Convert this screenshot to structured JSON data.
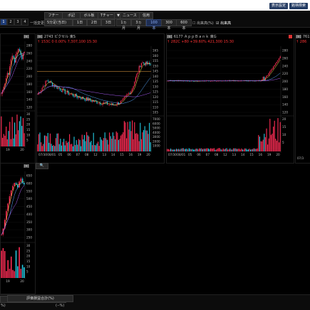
{
  "topbar": {
    "btn1": "表示設定",
    "btn2": "銘柄検索"
  },
  "toolbar": {
    "pages": [
      "1",
      "2",
      "3",
      "4"
    ],
    "list_label": "一括変更",
    "buttons": [
      "フチート",
      "ポ記",
      "ボル板",
      "Tチャート",
      "▼",
      "ニュース",
      "信用"
    ],
    "period_select": "5分足(当日)",
    "periods": [
      "1日",
      "2日",
      "3日",
      "1ヵ月",
      "3ヵ月",
      "100本",
      "300本",
      "600本"
    ],
    "active_period": "100本",
    "options": [
      "出来高(%)",
      "出来高"
    ]
  },
  "panels": [
    {
      "id": "panel-a",
      "header": "",
      "price_line": "",
      "y_ticks": [
        "280",
        "260",
        "240",
        "220",
        "200",
        "180",
        "160",
        "140",
        "120"
      ],
      "vol_ticks": [
        "30",
        "25",
        "20",
        "15",
        "10",
        "5"
      ],
      "x_ticks": [
        "19",
        "20"
      ]
    },
    {
      "id": "panel-b",
      "code": "2743",
      "name": "ピクセル",
      "market": "東S",
      "price_line": "↑ 153C  0 0.00%  7,307,100  15:30",
      "y_ticks": [
        "165",
        "160",
        "155",
        "150",
        "145",
        "140",
        "135",
        "130",
        "125",
        "120",
        "115",
        "110",
        "105"
      ],
      "vol_ticks": [
        "7000",
        "6000",
        "5000",
        "4000",
        "3000",
        "2000",
        "1000"
      ],
      "x_ticks": [
        "07/30",
        "08/01",
        "05",
        "06",
        "07",
        "08",
        "12",
        "13",
        "14",
        "15",
        "16",
        "19",
        "20"
      ]
    },
    {
      "id": "panel-c",
      "code": "6177",
      "name": "ＡｐｐＢａｎｋ",
      "market": "東G",
      "price_line": "↑ 282C  +80 +39.60%  421,300  15:30",
      "y_ticks": [
        "280",
        "260",
        "240",
        "220",
        "200",
        "180",
        "160",
        "140",
        "120"
      ],
      "vol_ticks": [
        "20",
        "15",
        "10",
        "5"
      ],
      "x_ticks": [
        "07/30",
        "08/01",
        "05",
        "06",
        "07",
        "08",
        "12",
        "13",
        "14",
        "15",
        "16",
        "19",
        "20"
      ]
    },
    {
      "id": "panel-d",
      "code": "7615",
      "name": "",
      "price_line": "↑ 286",
      "x_ticks": [
        "07/3"
      ]
    },
    {
      "id": "panel-e",
      "header": "",
      "y_ticks": [
        "650",
        "600",
        "550",
        "500",
        "450",
        "400",
        "350",
        "300",
        "250"
      ],
      "vol_ticks": [
        "30",
        "25",
        "20",
        "15",
        "10",
        "5"
      ],
      "x_ticks": [
        "19",
        "20"
      ]
    }
  ],
  "bottom": {
    "label": "評価損益合計(%)",
    "left": "%)",
    "right": "(--%)"
  },
  "chart_data": [
    {
      "type": "line",
      "title": "2743 ピクセル",
      "x": [
        "07/30",
        "08/01",
        "05",
        "06",
        "07",
        "08",
        "12",
        "13",
        "14",
        "15",
        "16",
        "19",
        "20"
      ],
      "series": [
        {
          "values": [
            120,
            135,
            128,
            122,
            118,
            115,
            112,
            110,
            108,
            112,
            125,
            155,
            152
          ]
        }
      ],
      "ylim": [
        100,
        168
      ]
    },
    {
      "type": "line",
      "title": "6177 AppBank",
      "x": [
        "07/30",
        "08/01",
        "05",
        "06",
        "07",
        "08",
        "12",
        "13",
        "14",
        "15",
        "16",
        "19",
        "20"
      ],
      "series": [
        {
          "values": [
            202,
            202,
            202,
            201,
            202,
            202,
            202,
            202,
            202,
            202,
            202,
            270,
            282
          ]
        }
      ],
      "ylim": [
        100,
        300
      ]
    }
  ]
}
